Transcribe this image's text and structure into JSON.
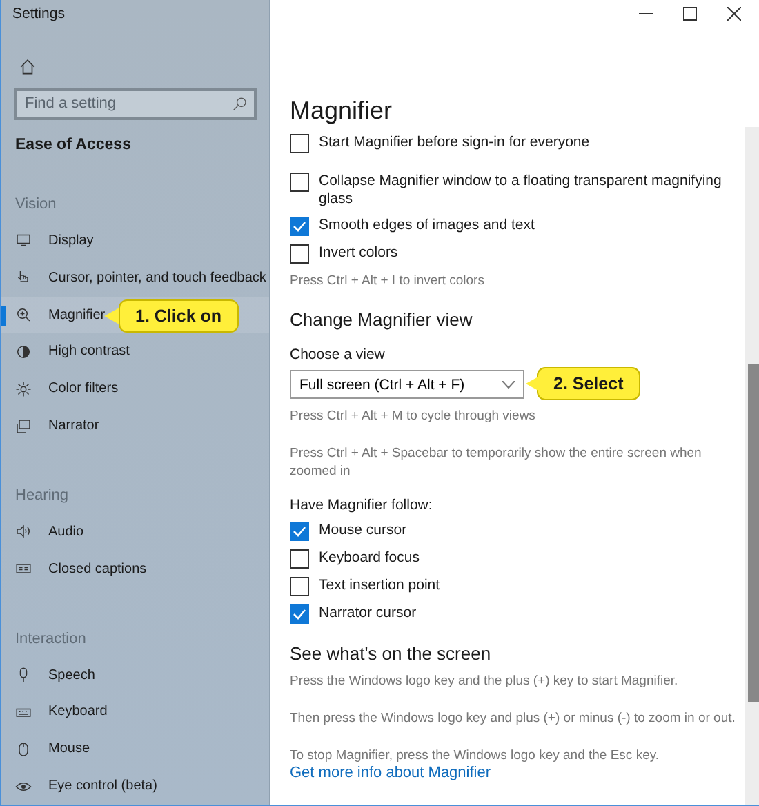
{
  "window": {
    "title": "Settings"
  },
  "sidebar": {
    "search": {
      "placeholder": "Find a setting"
    },
    "category": "Ease of Access",
    "groups": [
      {
        "heading": "Vision",
        "items": [
          {
            "label": "Display",
            "selected": false
          },
          {
            "label": "Cursor, pointer, and touch feedback",
            "selected": false
          },
          {
            "label": "Magnifier",
            "selected": true
          },
          {
            "label": "High contrast",
            "selected": false
          },
          {
            "label": "Color filters",
            "selected": false
          },
          {
            "label": "Narrator",
            "selected": false
          }
        ]
      },
      {
        "heading": "Hearing",
        "items": [
          {
            "label": "Audio",
            "selected": false
          },
          {
            "label": "Closed captions",
            "selected": false
          }
        ]
      },
      {
        "heading": "Interaction",
        "items": [
          {
            "label": "Speech",
            "selected": false
          },
          {
            "label": "Keyboard",
            "selected": false
          },
          {
            "label": "Mouse",
            "selected": false
          },
          {
            "label": "Eye control (beta)",
            "selected": false
          }
        ]
      }
    ]
  },
  "page": {
    "title": "Magnifier",
    "blocks": [
      {
        "kind": "checkbox",
        "label": "Start Magnifier before sign-in for everyone",
        "checked": false
      },
      {
        "kind": "checkbox",
        "label": "Collapse Magnifier window to a floating transparent magnifying glass",
        "checked": false
      },
      {
        "kind": "checkbox",
        "label": "Smooth edges of images and text",
        "checked": true
      },
      {
        "kind": "checkbox",
        "label": "Invert colors",
        "checked": false
      },
      {
        "kind": "hint",
        "text": "Press Ctrl + Alt + I to invert colors"
      },
      {
        "kind": "heading",
        "text": "Change Magnifier view"
      },
      {
        "kind": "label",
        "text": "Choose a view"
      },
      {
        "kind": "dropdown",
        "value": "Full screen (Ctrl + Alt + F)",
        "callout": "2. Select"
      },
      {
        "kind": "hint",
        "text": "Press Ctrl + Alt + M to cycle through views"
      },
      {
        "kind": "hint",
        "text": "Press Ctrl + Alt + Spacebar to temporarily show the entire screen when zoomed in"
      },
      {
        "kind": "label",
        "text": "Have Magnifier follow:"
      },
      {
        "kind": "checkbox",
        "label": "Mouse cursor",
        "checked": true
      },
      {
        "kind": "checkbox",
        "label": "Keyboard focus",
        "checked": false
      },
      {
        "kind": "checkbox",
        "label": "Text insertion point",
        "checked": false
      },
      {
        "kind": "checkbox",
        "label": "Narrator cursor",
        "checked": true
      },
      {
        "kind": "heading",
        "text": "See what's on the screen"
      },
      {
        "kind": "hint",
        "text": "Press the Windows logo key and the plus (+) key to start Magnifier."
      },
      {
        "kind": "hint",
        "text": "Then press the Windows logo key and plus (+) or minus (-) to zoom in or out."
      },
      {
        "kind": "hint",
        "text": "To stop Magnifier, press the Windows logo key and the Esc key."
      },
      {
        "kind": "link",
        "text": "Get more info about Magnifier"
      }
    ]
  },
  "callout": {
    "text": "1. Click on"
  }
}
